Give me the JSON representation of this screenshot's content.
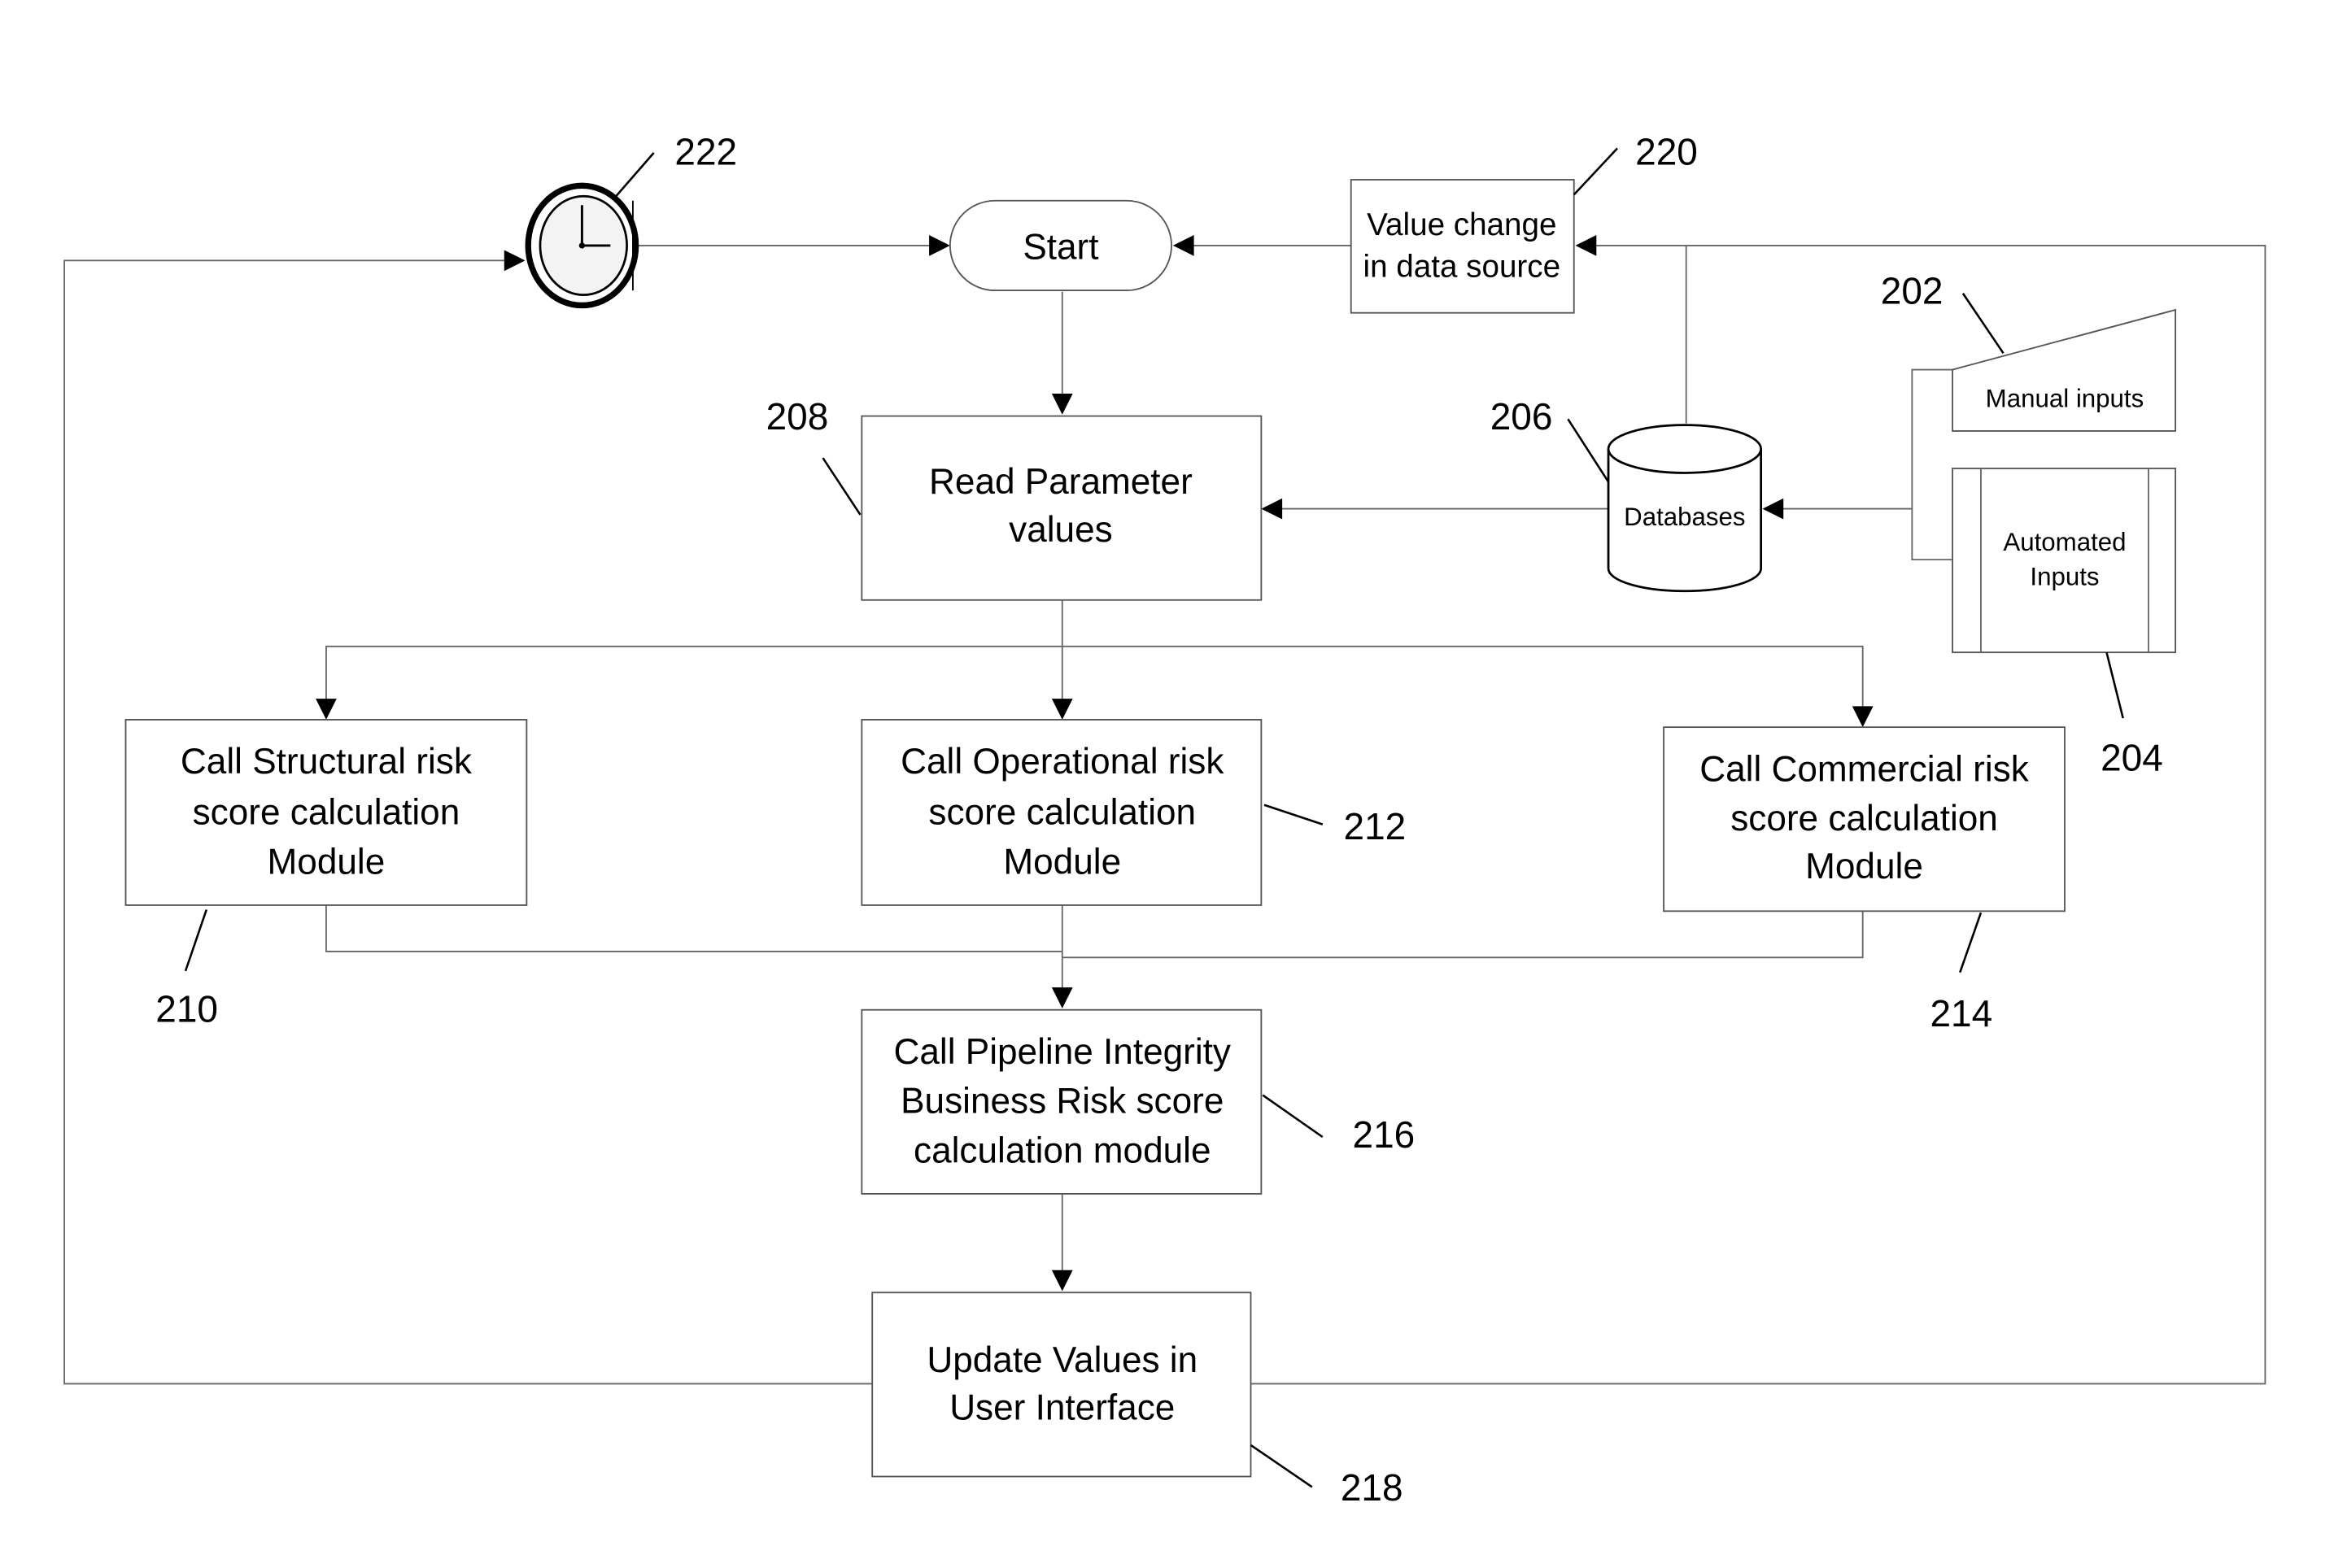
{
  "diagram": {
    "nodes": {
      "start": {
        "ref": "",
        "lines": [
          "Start"
        ]
      },
      "value_change": {
        "ref": "220",
        "lines": [
          "Value change",
          "in data source"
        ]
      },
      "timer": {
        "ref": "222",
        "icon": "clock-icon"
      },
      "read_params": {
        "ref": "208",
        "lines": [
          "Read Parameter",
          "values"
        ]
      },
      "databases": {
        "ref": "206",
        "lines": [
          "Databases"
        ]
      },
      "manual_inputs": {
        "ref": "202",
        "lines": [
          "Manual inputs"
        ]
      },
      "automated_inputs": {
        "ref": "204",
        "lines": [
          "Automated",
          "Inputs"
        ]
      },
      "structural": {
        "ref": "210",
        "lines": [
          "Call Structural risk",
          "score calculation",
          "Module"
        ]
      },
      "operational": {
        "ref": "212",
        "lines": [
          "Call Operational risk",
          "score calculation",
          "Module"
        ]
      },
      "commercial": {
        "ref": "214",
        "lines": [
          "Call Commercial risk",
          "score calculation",
          "Module"
        ]
      },
      "pipeline": {
        "ref": "216",
        "lines": [
          "Call Pipeline Integrity",
          "Business Risk score",
          "calculation module"
        ]
      },
      "update_ui": {
        "ref": "218",
        "lines": [
          "Update Values in",
          "User Interface"
        ]
      }
    }
  }
}
